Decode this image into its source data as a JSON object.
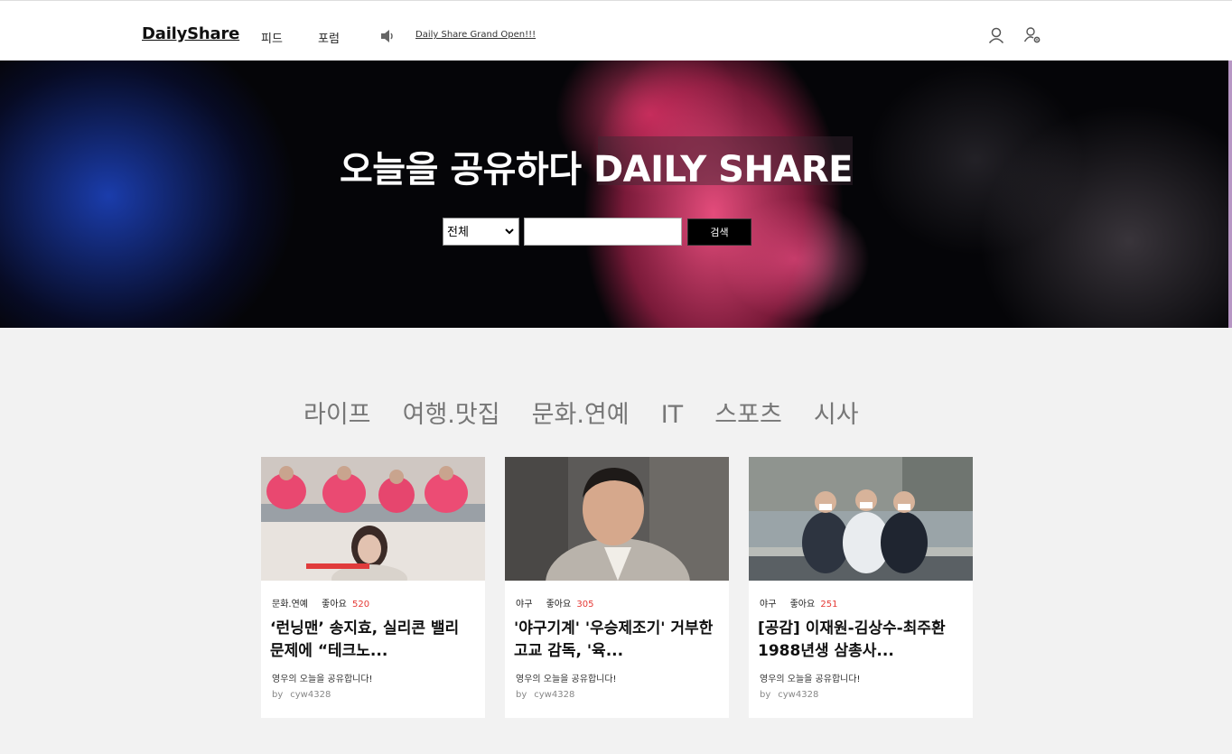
{
  "header": {
    "logo": "DailyShare",
    "nav": [
      "피드",
      "포럼"
    ],
    "notice": "Daily Share Grand Open!!!"
  },
  "hero": {
    "title": "오늘을 공유하다 DAILY SHARE",
    "select_value": "전체",
    "search_button": "검색"
  },
  "categories": [
    "라이프",
    "여행.맛집",
    "문화.연예",
    "IT",
    "스포츠",
    "시사"
  ],
  "cards": [
    {
      "category": "문화.연예",
      "likes_label": "좋아요",
      "likes": "520",
      "title": "‘런닝맨’ 송지효, 실리콘 밸리 문제에 “테크노...",
      "desc": "영우의 오늘을 공유합니다!",
      "by": "by",
      "author": "cyw4328"
    },
    {
      "category": "야구",
      "likes_label": "좋아요",
      "likes": "305",
      "title": "'야구기계' '우승제조기' 거부한 고교 감독, '육...",
      "desc": "영우의 오늘을 공유합니다!",
      "by": "by",
      "author": "cyw4328"
    },
    {
      "category": "야구",
      "likes_label": "좋아요",
      "likes": "251",
      "title": "[공감] 이재원-김상수-최주환 1988년생 삼총사...",
      "desc": "영우의 오늘을 공유합니다!",
      "by": "by",
      "author": "cyw4328"
    }
  ],
  "icons": {
    "speaker": "speaker-icon",
    "user": "user-icon",
    "user_settings": "user-settings-icon"
  }
}
